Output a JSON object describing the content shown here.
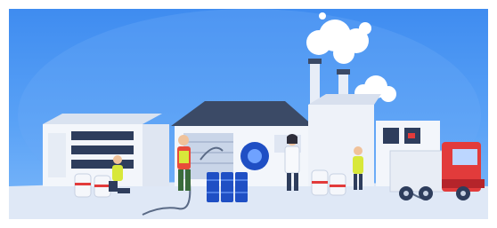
{
  "scene": {
    "kind": "industrial-illustration",
    "palette": {
      "sky": "#4a93f3",
      "ground": "#eaf1fb",
      "building": "#f3f6fb",
      "roof": "#3b4a66",
      "smoke": "#ffffff",
      "barrel_blue": "#1f4fc4",
      "truck_red": "#e23b3b",
      "vest_yellow": "#d8e83a",
      "worker_red": "#e84b3a"
    },
    "elements": [
      "left-warehouse",
      "main-factory",
      "smokestacks",
      "smoke-clouds",
      "blue-barrels",
      "storage-tanks",
      "red-truck",
      "worker-kneeling",
      "worker-with-hose",
      "scientist",
      "worker-right"
    ]
  }
}
